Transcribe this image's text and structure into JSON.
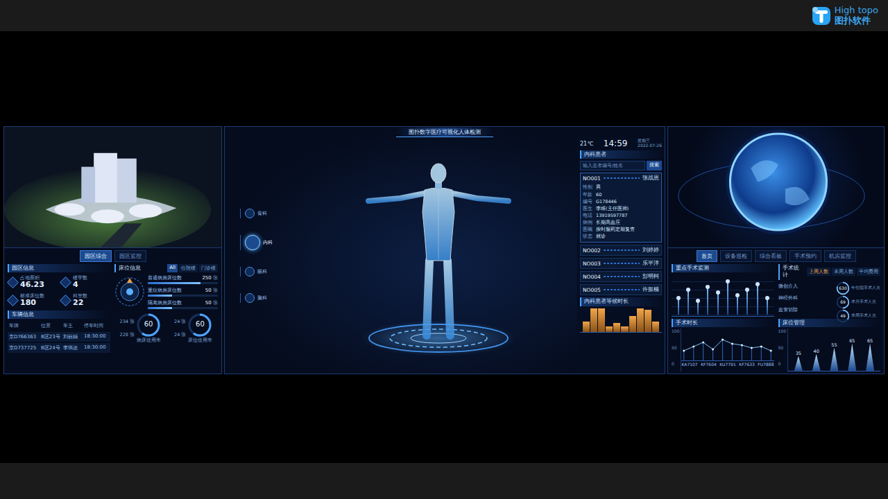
{
  "brand": {
    "name": "High topo",
    "sub": "图扑软件"
  },
  "left": {
    "tabs": [
      {
        "label": "园区综合",
        "selected": true
      },
      {
        "label": "园区监控",
        "selected": false
      }
    ],
    "park": {
      "title": "园区信息",
      "stats": [
        {
          "label": "占地面积",
          "value": "46.23"
        },
        {
          "label": "楼宇数",
          "value": "4"
        },
        {
          "label": "标准床位数",
          "value": "180"
        },
        {
          "label": "科室数",
          "value": "22"
        }
      ]
    },
    "vehicles": {
      "title": "车辆信息",
      "columns": [
        "车牌",
        "位置",
        "车主",
        "停车时间"
      ],
      "rows": [
        [
          "京D766363",
          "B区23号",
          "刘丽娟",
          "18:30:00"
        ],
        [
          "京D737725",
          "B区24号",
          "李琪达",
          "18:30:00"
        ]
      ]
    },
    "beds": {
      "title": "床位信息",
      "tabs": [
        {
          "label": "All",
          "selected": true
        },
        {
          "label": "住院楼",
          "selected": false
        },
        {
          "label": "门诊楼",
          "selected": false
        }
      ],
      "bars": [
        {
          "label": "普通病房床位数",
          "value": "250",
          "unit": "张",
          "level": 0.75
        },
        {
          "label": "重症病房床位数",
          "value": "50",
          "unit": "张",
          "level": 0.35
        },
        {
          "label": "隔离病房床位数",
          "value": "50",
          "unit": "张",
          "level": 0.35
        }
      ],
      "gauges": [
        {
          "value": "60",
          "label": "病床使用率",
          "sideTop": "234 张",
          "sideBottom": "228 张",
          "level": 0.6
        },
        {
          "value": "60",
          "label": "床位使用率",
          "sideTop": "24 张",
          "sideBottom": "24 张",
          "level": 0.6
        }
      ]
    }
  },
  "center": {
    "title": "图扑数字医疗可视化人体检测",
    "departments": [
      {
        "label": "骨科",
        "selected": false
      },
      {
        "label": "内科",
        "selected": true
      },
      {
        "label": "眼科",
        "selected": false
      },
      {
        "label": "脑科",
        "selected": false
      }
    ],
    "weather": "21℃",
    "time": "14:59",
    "weekday": "星期三",
    "date": "2022-07-26",
    "patients": {
      "title": "内科患者",
      "placeholder": "输入患者编号/姓名",
      "button": "搜索",
      "items": [
        {
          "id": "NO001",
          "name": "张战恩",
          "expanded": true,
          "details": [
            {
              "label": "性别",
              "value": "男"
            },
            {
              "label": "年龄",
              "value": "60"
            },
            {
              "label": "编号",
              "value": "G178446"
            },
            {
              "label": "医生",
              "value": "李维(主任医师)"
            },
            {
              "label": "电话",
              "value": "13919597787"
            },
            {
              "label": "病例",
              "value": "长期高血压"
            },
            {
              "label": "医嘱",
              "value": "按时服药定期复查"
            },
            {
              "label": "状态",
              "value": "就诊"
            }
          ]
        },
        {
          "id": "NO002",
          "name": "刘婷婷",
          "expanded": false,
          "details": []
        },
        {
          "id": "NO003",
          "name": "乐平洋",
          "expanded": false,
          "details": []
        },
        {
          "id": "NO004",
          "name": "彭明柯",
          "expanded": false,
          "details": []
        },
        {
          "id": "NO005",
          "name": "许振楠",
          "expanded": false,
          "details": []
        }
      ]
    },
    "waitChart": {
      "title": "内科患者等候时长",
      "values": [
        40,
        90,
        90,
        20,
        35,
        20,
        60,
        90,
        85,
        40
      ]
    }
  },
  "right": {
    "tabs": [
      {
        "label": "首页",
        "selected": true
      },
      {
        "label": "设备巡检",
        "selected": false
      },
      {
        "label": "综合看板",
        "selected": false
      },
      {
        "label": "手术预约",
        "selected": false
      },
      {
        "label": "机房监控",
        "selected": false
      }
    ],
    "keyOps": {
      "title": "重点手术监测",
      "values": [
        30,
        45,
        25,
        50,
        40,
        60,
        35,
        45,
        55,
        30
      ]
    },
    "opStats": {
      "title": "手术统计",
      "tabs": [
        {
          "label": "上周人数",
          "selected": true
        },
        {
          "label": "本周人数",
          "selected": false
        },
        {
          "label": "平均费用",
          "selected": false
        }
      ],
      "rows": [
        {
          "label": "微创介入",
          "level": 0.6
        },
        {
          "label": "神经外科",
          "level": 0.4
        },
        {
          "label": "血管切除",
          "level": 0.5
        }
      ],
      "circles": [
        {
          "value": "630",
          "label": "年住院手术人次",
          "level": 0.8
        },
        {
          "value": "69",
          "label": "本月手术人次",
          "level": 0.5
        },
        {
          "value": "49",
          "label": "本周手术人次",
          "level": 0.35
        }
      ]
    },
    "opDuration": {
      "title": "手术时长",
      "yTicks": [
        "100",
        "50",
        "0"
      ],
      "labels": [
        "KA7107",
        "KF7604",
        "KU7791",
        "KF7633",
        "FU7888"
      ],
      "values": [
        30,
        45,
        60,
        35,
        70,
        55,
        50,
        40,
        45,
        30
      ]
    },
    "bedMgmt": {
      "title": "床位管理",
      "yTicks": [
        "100",
        "50",
        "0"
      ],
      "points": [
        {
          "value": 35,
          "label": "35"
        },
        {
          "value": 40,
          "label": "40"
        },
        {
          "value": 55,
          "label": "55"
        },
        {
          "value": 65,
          "label": "65"
        },
        {
          "value": 65,
          "label": "65"
        }
      ]
    }
  }
}
